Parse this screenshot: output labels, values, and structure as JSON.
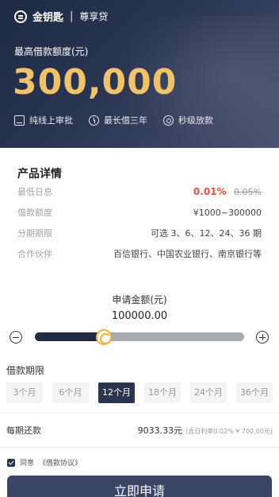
{
  "brand": {
    "name": "金钥匙",
    "separator": "|",
    "product": "尊享贷"
  },
  "hero": {
    "max_label": "最高借款额度(元)",
    "max_amount": "300,000",
    "features": [
      {
        "icon": "document-icon",
        "label": "纯线上审批"
      },
      {
        "icon": "clock-icon",
        "label": "最长借三年"
      },
      {
        "icon": "lightning-icon",
        "label": "秒级放款"
      }
    ]
  },
  "details": {
    "title": "产品详情",
    "rows": [
      {
        "key": "最低日息",
        "value": "0.01%",
        "old_value": "0.05%"
      },
      {
        "key": "借款额度",
        "value": "¥1000~300000"
      },
      {
        "key": "分期期限",
        "value": "可选 3、6、12、24、36 期"
      },
      {
        "key": "合作伙伴",
        "value": "百信银行、中国农业银行、南京银行等"
      }
    ]
  },
  "slider": {
    "label": "申请金额(元)",
    "value": "100000.00",
    "fraction": 0.33
  },
  "period": {
    "label": "借款期限",
    "options": [
      "3个月",
      "6个月",
      "12个月",
      "18个月",
      "24个月",
      "36个月"
    ],
    "selected": "12个月"
  },
  "repay": {
    "label": "每期还款",
    "amount": "9033.33元",
    "note": "(含日利率0.02% ¥ 700.00元)"
  },
  "agreement": {
    "prefix": "同意",
    "link": "《借款协议》",
    "checked": true
  },
  "apply_button": "立即申请",
  "colors": {
    "navy": "#1f2a44",
    "gold": "#f0c36a",
    "red": "#f04c3e",
    "button": "#3a4566"
  }
}
